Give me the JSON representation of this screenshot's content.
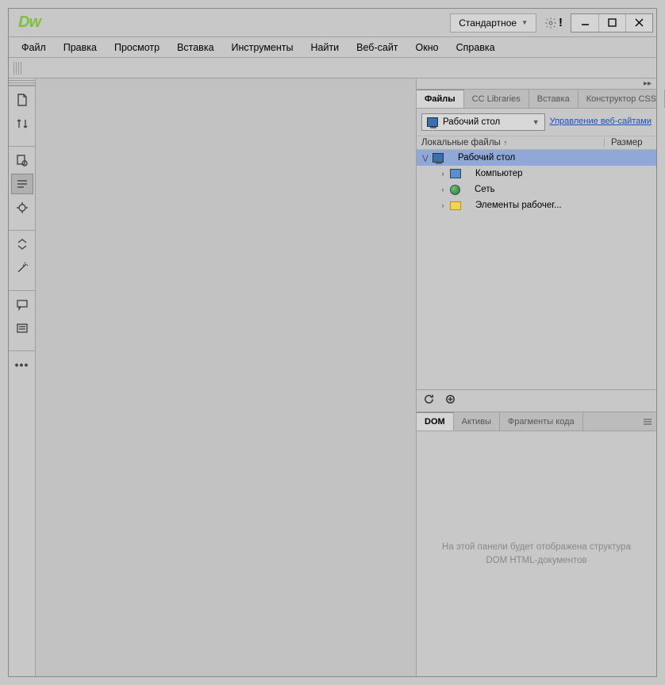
{
  "app_logo": "Dw",
  "titlebar": {
    "workspace_label": "Стандартное"
  },
  "menu": {
    "file": "Файл",
    "edit": "Правка",
    "view": "Просмотр",
    "insert": "Вставка",
    "tools": "Инструменты",
    "find": "Найти",
    "site": "Веб-сайт",
    "window": "Окно",
    "help": "Справка"
  },
  "panels": {
    "collapse": "▸▸",
    "files_tabs": {
      "files": "Файлы",
      "cc_libraries": "CC Libraries",
      "insert": "Вставка",
      "css_designer": "Конструктор CSS"
    },
    "dom_tabs": {
      "dom": "DOM",
      "assets": "Активы",
      "snippets": "Фрагменты кода"
    }
  },
  "files": {
    "site_selected": "Рабочий стол",
    "manage_link": "Управление веб-сайтами",
    "header_name": "Локальные файлы",
    "header_size": "Размер",
    "tree": {
      "root": "Рабочий стол",
      "computer": "Компьютер",
      "network": "Сеть",
      "desktop_items": "Элементы рабочег..."
    }
  },
  "dom": {
    "placeholder": "На этой панели будет отображена структура DOM HTML-документов"
  }
}
